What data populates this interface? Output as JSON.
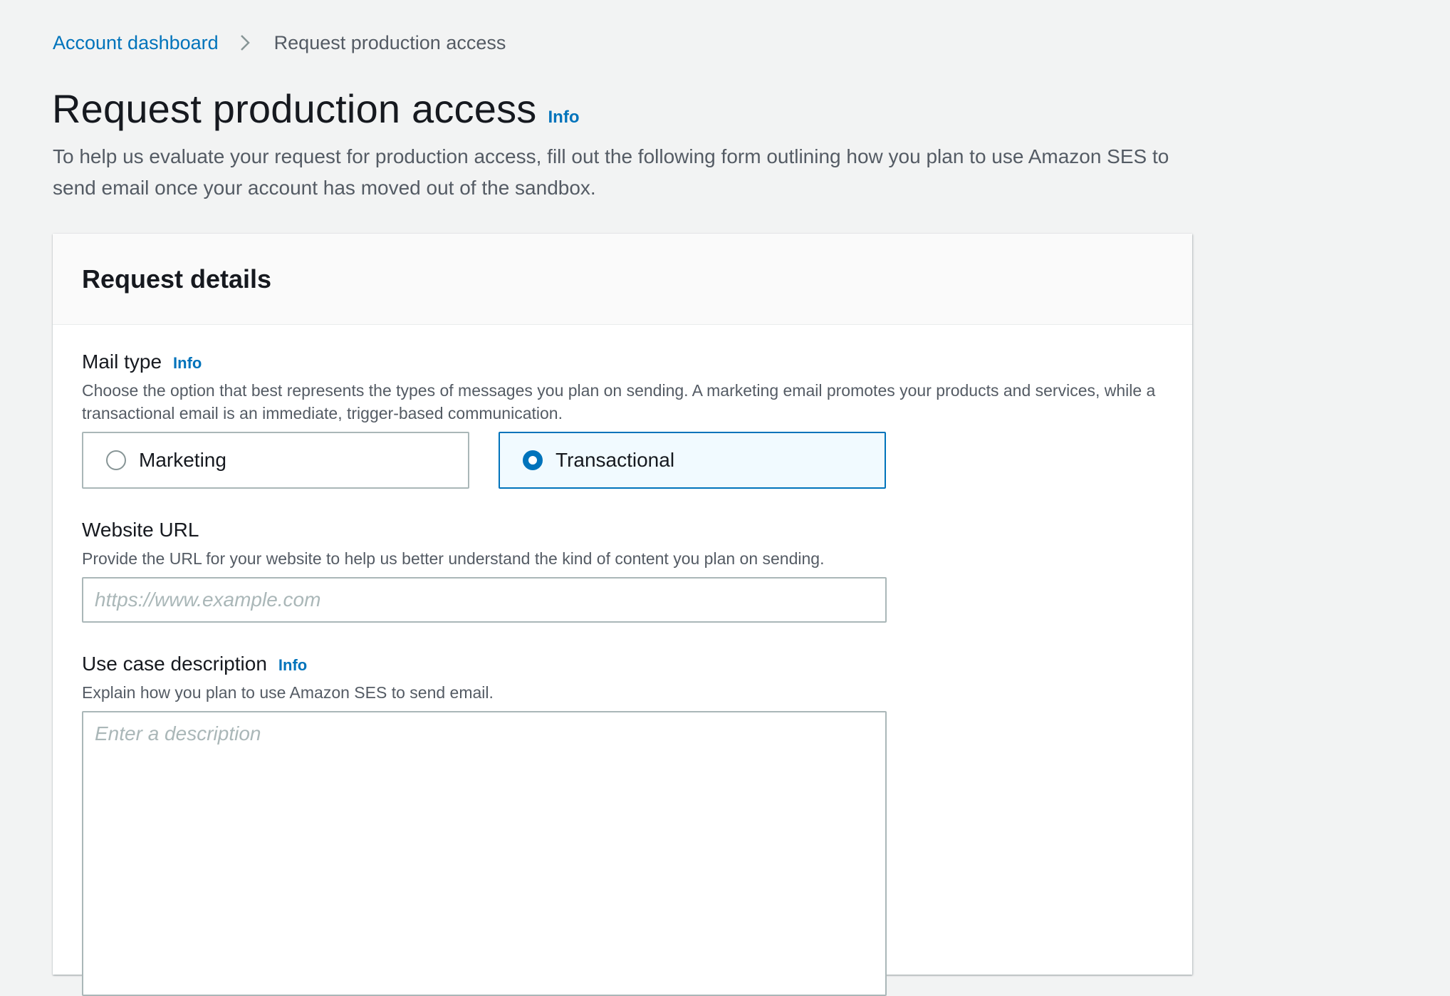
{
  "breadcrumb": {
    "items": [
      {
        "label": "Account dashboard",
        "link": true
      },
      {
        "label": "Request production access",
        "link": false
      }
    ],
    "separator_icon": "chevron-right-icon"
  },
  "page": {
    "title": "Request production access",
    "info_label": "Info",
    "description": "To help us evaluate your request for production access, fill out the following form outlining how you plan to use Amazon SES to send email once your account has moved out of the sandbox."
  },
  "panel": {
    "title": "Request details"
  },
  "mail_type": {
    "label": "Mail type",
    "info_label": "Info",
    "description": "Choose the option that best represents the types of messages you plan on sending. A marketing email promotes your products and services, while a transactional email is an immediate, trigger-based communication.",
    "options": [
      {
        "label": "Marketing",
        "selected": false
      },
      {
        "label": "Transactional",
        "selected": true
      }
    ],
    "selected_value": "Transactional"
  },
  "website_url": {
    "label": "Website URL",
    "description": "Provide the URL for your website to help us better understand the kind of content you plan on sending.",
    "placeholder": "https://www.example.com",
    "value": ""
  },
  "use_case": {
    "label": "Use case description",
    "info_label": "Info",
    "description": "Explain how you plan to use Amazon SES to send email.",
    "placeholder": "Enter a description",
    "value": ""
  },
  "colors": {
    "link": "#0073bb",
    "background": "#f2f3f3",
    "selected_tile_bg": "#f1faff",
    "border": "#aab7b8",
    "text_secondary": "#545b64"
  }
}
